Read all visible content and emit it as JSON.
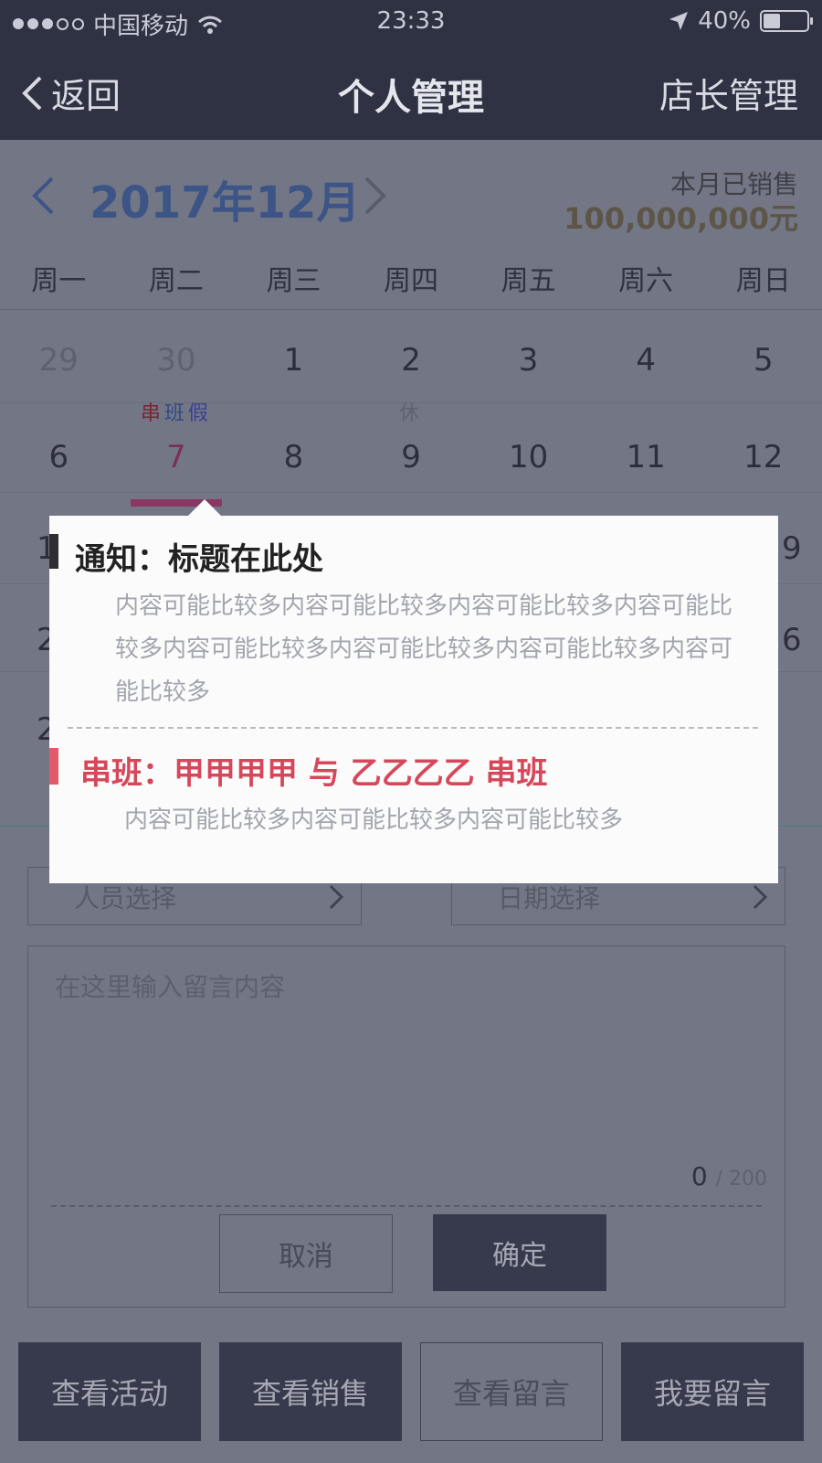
{
  "status_bar": {
    "carrier": "中国移动",
    "time": "23:33",
    "battery": "40%",
    "icons": [
      "signal-dots-icon",
      "wifi-icon",
      "location-arrow-icon",
      "battery-icon"
    ]
  },
  "nav": {
    "back_label": "返回",
    "title": "个人管理",
    "right_label": "店长管理"
  },
  "calendar": {
    "month_title": "2017年12月",
    "sales_label": "本月已销售",
    "sales_value": "100,000,000元",
    "weekdays": [
      "周一",
      "周二",
      "周三",
      "周四",
      "周五",
      "周六",
      "周日"
    ],
    "week1": [
      "29",
      "30",
      "1",
      "2",
      "3",
      "4",
      "5"
    ],
    "week2": [
      "6",
      "7",
      "8",
      "9",
      "10",
      "11",
      "12"
    ],
    "day7_tags": [
      "串",
      "班",
      "假"
    ],
    "day9_tag": "休",
    "partial_row3_left": "1",
    "partial_row3_right": "9",
    "partial_row4_left": "2",
    "partial_row4_right": "6",
    "partial_row5_left": "2"
  },
  "form": {
    "person_select": "人员选择",
    "date_select": "日期选择",
    "message_placeholder": "在这里输入留言内容",
    "count_current": "0",
    "count_max": "/ 200",
    "cancel": "取消",
    "confirm": "确定"
  },
  "bottom_buttons": [
    "查看活动",
    "查看销售",
    "查看留言",
    "我要留言"
  ],
  "popup": {
    "notice_title": "通知：标题在此处",
    "notice_body": "内容可能比较多内容可能比较多内容可能比较多内容可能比较多内容可能比较多内容可能比较多内容可能比较多内容可能比较多",
    "shift_title": "串班：甲甲甲甲 与 乙乙乙乙 串班",
    "shift_body": "内容可能比较多内容可能比较多内容可能比较多"
  },
  "colors": {
    "nav_bg": "#2e3243",
    "overlay_bg": "#737785",
    "accent_red": "#d6475a",
    "selected_day": "#8a3764"
  }
}
